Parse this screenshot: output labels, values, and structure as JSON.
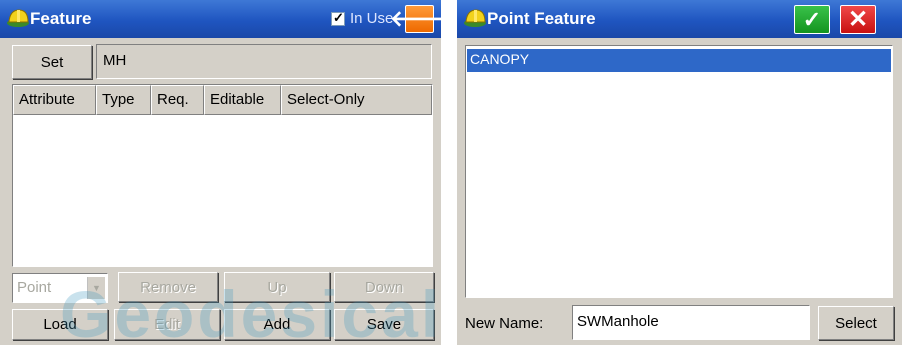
{
  "left": {
    "title": "Feature",
    "in_use_label": "In Use",
    "in_use_checked": true,
    "set_label": "Set",
    "set_value": "MH",
    "columns": [
      "Attribute",
      "Type",
      "Req.",
      "Editable",
      "Select-Only"
    ],
    "type_combo": "Point",
    "buttons": {
      "remove": "Remove",
      "up": "Up",
      "down": "Down",
      "load": "Load",
      "edit": "Edit",
      "add": "Add",
      "save": "Save"
    }
  },
  "right": {
    "title": "Point Feature",
    "list_items": [
      "CANOPY"
    ],
    "new_name_label": "New Name:",
    "new_name_value": "SWManhole",
    "select_label": "Select"
  },
  "watermark": "Geodesical",
  "colors": {
    "titlebar": "#1f55c0",
    "selection": "#2e68c8",
    "ok": "#14941f",
    "close": "#c81010",
    "back": "#ee6a00"
  },
  "icons": {
    "app": "hardhat-icon",
    "back": "arrow-left-icon",
    "ok": "checkmark-icon",
    "close": "x-icon"
  }
}
